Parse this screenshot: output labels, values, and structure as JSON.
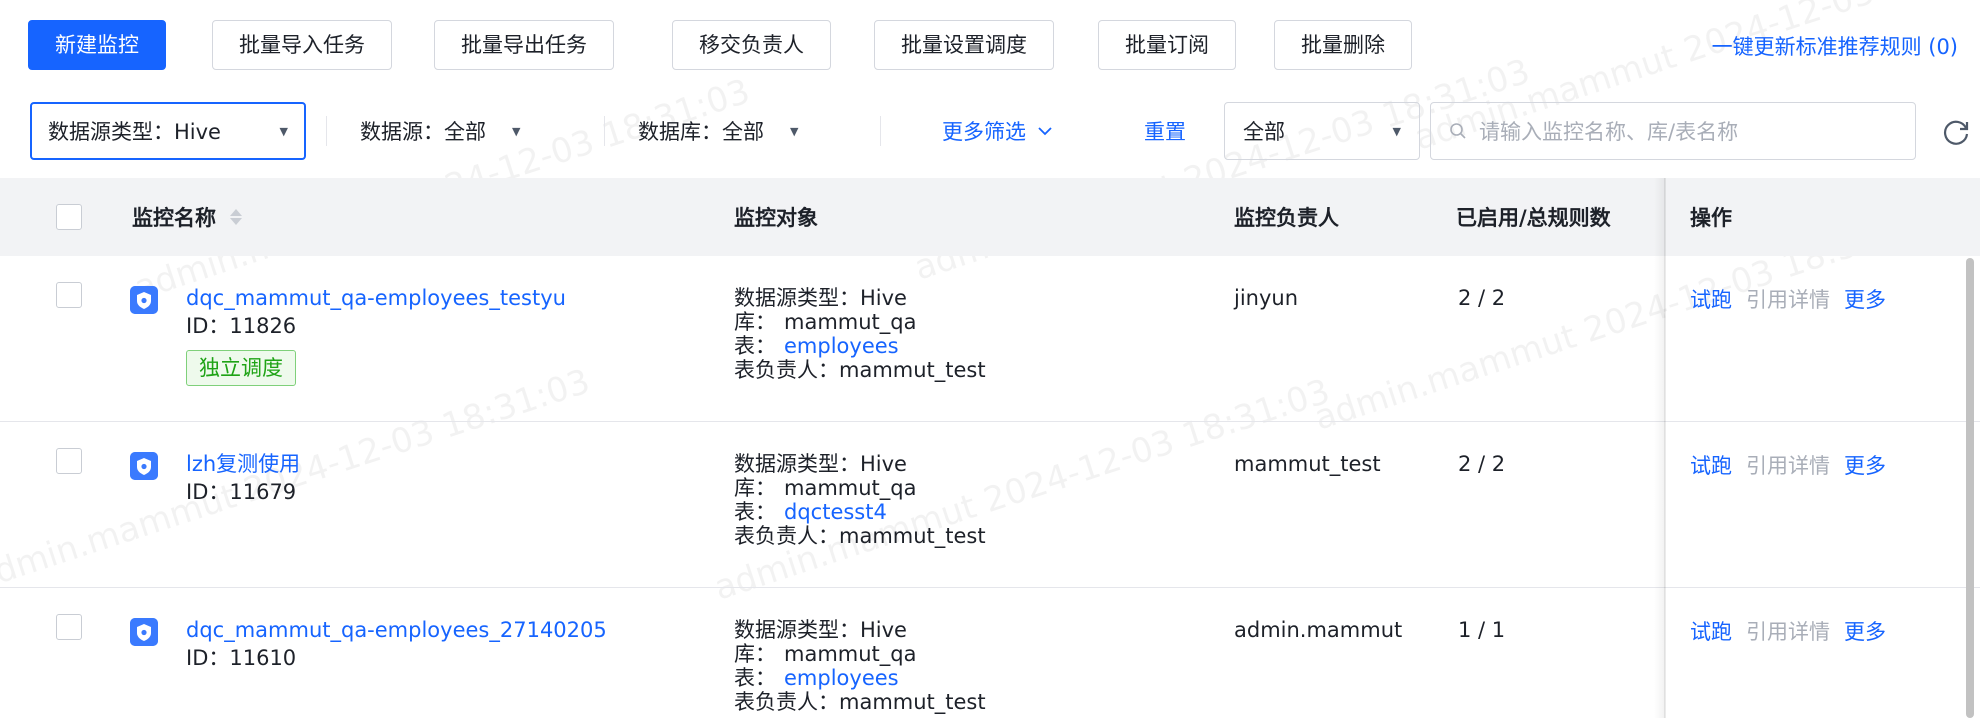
{
  "toolbar": {
    "new_monitor": "新建监控",
    "batch_import": "批量导入任务",
    "batch_export": "批量导出任务",
    "transfer_owner": "移交负责人",
    "batch_schedule": "批量设置调度",
    "batch_subscribe": "批量订阅",
    "batch_delete": "批量删除",
    "update_rules_link": "一键更新标准推荐规则 (0)"
  },
  "filters": {
    "datasource_type": "数据源类型：Hive",
    "datasource": "数据源：全部",
    "database": "数据库：全部",
    "more_filters": "更多筛选",
    "reset": "重置",
    "status_value": "全部",
    "search_placeholder": "请输入监控名称、库/表名称"
  },
  "table": {
    "headers": {
      "name": "监控名称",
      "object": "监控对象",
      "owner": "监控负责人",
      "rules": "已启用/总规则数",
      "ops": "操作"
    },
    "op_labels": {
      "trial": "试跑",
      "ref": "引用详情",
      "more": "更多"
    },
    "rows": [
      {
        "name": "dqc_mammut_qa-employees_testyu",
        "id": "ID：11826",
        "badge": "独立调度",
        "ds_type": "数据源类型：Hive",
        "db_label": "库：",
        "db": "mammut_qa",
        "table_label": "表：",
        "table": "employees",
        "table_owner": "表负责人：mammut_test",
        "owner": "jinyun",
        "rules": "2 / 2"
      },
      {
        "name": "lzh复测使用",
        "id": "ID：11679",
        "badge": "",
        "ds_type": "数据源类型：Hive",
        "db_label": "库：",
        "db": "mammut_qa",
        "table_label": "表：",
        "table": "dqctesst4",
        "table_owner": "表负责人：mammut_test",
        "owner": "mammut_test",
        "rules": "2 / 2"
      },
      {
        "name": "dqc_mammut_qa-employees_27140205",
        "id": "ID：11610",
        "badge": "",
        "ds_type": "数据源类型：Hive",
        "db_label": "库：",
        "db": "mammut_qa",
        "table_label": "表：",
        "table": "employees",
        "table_owner": "表负责人：mammut_test",
        "owner": "admin.mammut",
        "rules": "1 / 1"
      }
    ]
  },
  "watermark": "admin.mammut 2024-12-03 18:31:03",
  "colors": {
    "primary": "#1664ff",
    "badge_green": "#1fa316",
    "header_bg": "#f2f3f5"
  }
}
